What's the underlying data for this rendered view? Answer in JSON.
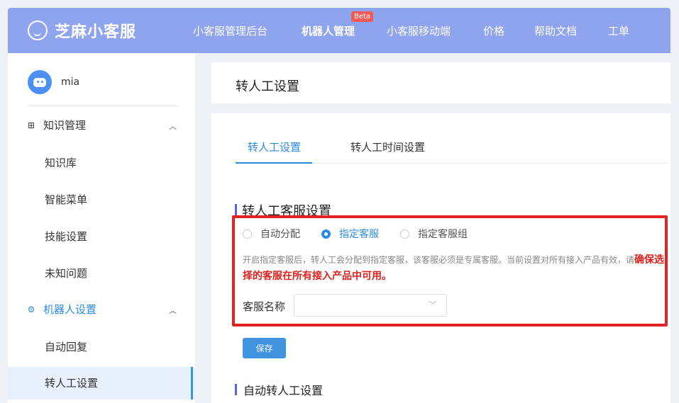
{
  "app": {
    "logo_text": "芝麻小客服"
  },
  "nav": {
    "items": [
      "小客服管理后台",
      "机器人管理",
      "小客服移动端",
      "价格",
      "帮助文档",
      "工单"
    ],
    "beta_badge": "Beta",
    "active": "机器人管理"
  },
  "sidebar": {
    "user_name": "mia",
    "groups": [
      {
        "label": "知识管理",
        "icon": "grid-icon",
        "items": [
          "知识库",
          "智能菜单",
          "技能设置",
          "未知问题"
        ]
      },
      {
        "label": "机器人设置",
        "icon": "gear-icon",
        "items": [
          "自动回复",
          "转人工设置"
        ]
      }
    ],
    "active_item": "转人工设置"
  },
  "header": {
    "title": "转人工设置"
  },
  "tabs": [
    "转人工设置",
    "转人工时间设置"
  ],
  "section": {
    "title": "转人工客服设置",
    "radios": [
      "自动分配",
      "指定客服",
      "指定客服组"
    ],
    "selected": "指定客服",
    "desc_normal": "开启指定客服后，转人工会分配到指定客服，该客服必须是专属客服。当前设置对所有接入产品有效，请",
    "desc_warn": "确保选择的客服在所有接入产品中可用。",
    "field_label": "客服名称",
    "select_value": "",
    "save_label": "保存"
  },
  "section2": {
    "title": "自动转人工设置"
  },
  "colors": {
    "accent": "#2b8be3",
    "topbar": "#8fa4ef",
    "highlight_box": "#e32222"
  }
}
